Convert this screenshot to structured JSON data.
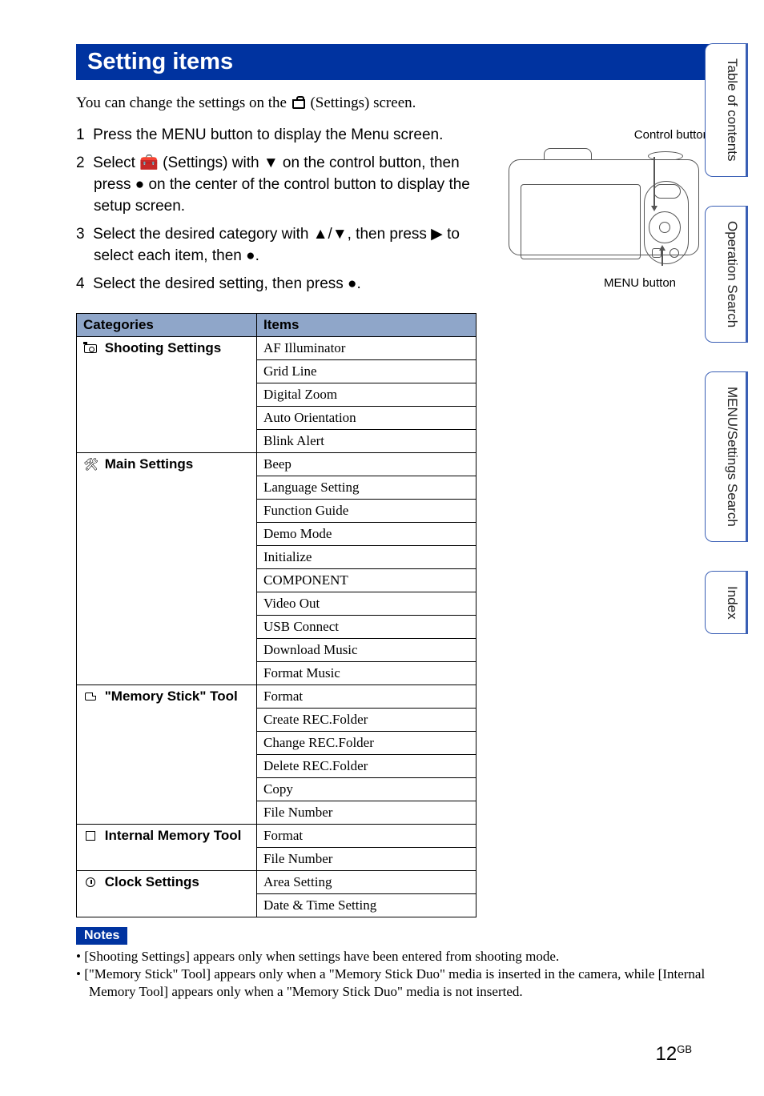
{
  "heading": "Setting items",
  "intro_pre": "You can change the settings on the ",
  "intro_post": " (Settings) screen.",
  "steps": [
    {
      "n": "1",
      "text": "Press the MENU button to display the Menu screen."
    },
    {
      "n": "2",
      "text": "Select 🧰 (Settings) with ▼ on the control button, then press ● on the center of the control button to display the setup screen."
    },
    {
      "n": "3",
      "text": "Select the desired category with ▲/▼, then press ▶ to select each item, then ●."
    },
    {
      "n": "4",
      "text": "Select the desired setting, then press ●."
    }
  ],
  "illus": {
    "top": "Control button",
    "bottom": "MENU button"
  },
  "table": {
    "head_cat": "Categories",
    "head_items": "Items",
    "groups": [
      {
        "icon": "cam",
        "label": "Shooting Settings",
        "items": [
          "AF Illuminator",
          "Grid Line",
          "Digital Zoom",
          "Auto Orientation",
          "Blink Alert"
        ]
      },
      {
        "icon": "wrench",
        "label": "Main Settings",
        "items": [
          "Beep",
          "Language Setting",
          "Function Guide",
          "Demo Mode",
          "Initialize",
          "COMPONENT",
          "Video Out",
          "USB Connect",
          "Download Music",
          "Format Music"
        ]
      },
      {
        "icon": "card",
        "label": "\"Memory Stick\" Tool",
        "items": [
          "Format",
          "Create REC.Folder",
          "Change REC.Folder",
          "Delete REC.Folder",
          "Copy",
          "File Number"
        ]
      },
      {
        "icon": "chip",
        "label": "Internal Memory Tool",
        "items": [
          "Format",
          "File Number"
        ]
      },
      {
        "icon": "clock",
        "label": "Clock Settings",
        "items": [
          "Area Setting",
          "Date & Time Setting"
        ]
      }
    ]
  },
  "notes_label": "Notes",
  "notes": [
    "[Shooting Settings] appears only when settings have been entered from shooting mode.",
    "[\"Memory Stick\" Tool] appears only when a \"Memory Stick Duo\" media is inserted in the camera, while [Internal Memory Tool] appears only when a \"Memory Stick Duo\" media is not inserted."
  ],
  "sidetabs": [
    "Table of contents",
    "Operation Search",
    "MENU/Settings Search",
    "Index"
  ],
  "page_number": "12",
  "page_suffix": "GB"
}
